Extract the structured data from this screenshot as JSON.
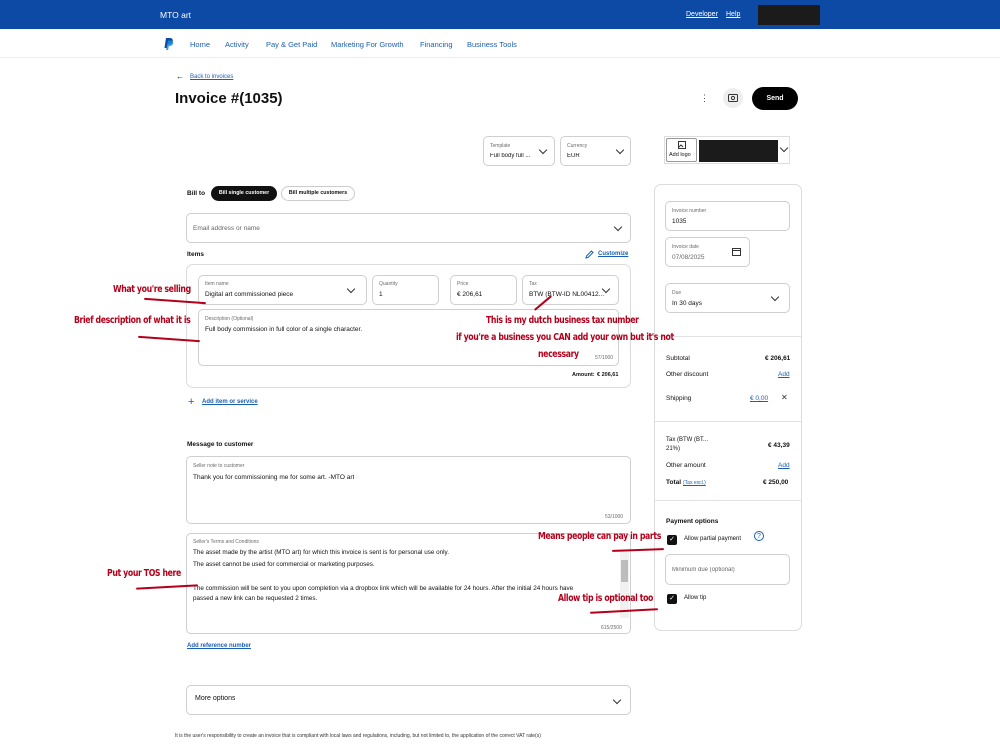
{
  "topbar": {
    "brand": "MTO art",
    "developer": "Developer",
    "help": "Help"
  },
  "nav": [
    "Home",
    "Activity",
    "Pay & Get Paid",
    "Marketing For Growth",
    "Financing",
    "Business Tools"
  ],
  "header": {
    "back": "Back to invoices",
    "title": "Invoice #(1035)",
    "more": "⋮",
    "send": "Send"
  },
  "template": {
    "label": "Template",
    "value": "Full body full ..."
  },
  "currency": {
    "label": "Currency",
    "value": "EUR"
  },
  "logo": {
    "label": "Add logo"
  },
  "billto": {
    "label": "Bill to",
    "single": "Bill single customer",
    "multiple": "Bill multiple customers",
    "email_placeholder": "Email address or name"
  },
  "items": {
    "title": "Items",
    "customize": "Customize",
    "item_name_label": "Item name",
    "item_name": "Digital art commissioned piece",
    "quantity_label": "Quantity",
    "quantity": "1",
    "price_label": "Price",
    "price": "€ 206,61",
    "tax_label": "Tax",
    "tax": "BTW (BTW-ID NL00412...",
    "desc_label": "Description (Optional)",
    "desc": "Full body commission in full color of a single character.",
    "desc_count": "57/1000",
    "amount_label": "Amount:",
    "amount": "€ 206,61",
    "add_item": "Add item or service"
  },
  "message": {
    "title": "Message to customer",
    "note_label": "Seller note to customer",
    "note": "Thank you for commissioning me for some art. -MTO art",
    "note_count": "53/1000",
    "terms_label": "Seller's Terms and Conditions",
    "terms_lines": [
      "The asset made by the artist (MTO art) for which this invoice is sent is for personal use only.",
      "The asset cannot be used for commercial or marketing purposes.",
      "",
      "The commission will be sent to you upon completion via a dropbox link which will be available for 24 hours. After the initial 24 hours have",
      "passed a new link can be requested 2 times."
    ],
    "terms_count": "615/2500",
    "add_reference": "Add reference number"
  },
  "more_options": "More options",
  "footer": "It is the user's responsibility to create an invoice that is compliant with local laws and regulations, including, but not limited to, the application of the correct VAT rate(s)",
  "side": {
    "inv_num_label": "Invoice number",
    "inv_num": "1035",
    "inv_date_label": "Invoice date",
    "inv_date": "07/08/2025",
    "due_label": "Due",
    "due": "In 30 days",
    "subtotal_label": "Subtotal",
    "subtotal": "€ 206,61",
    "discount_label": "Other discount",
    "add": "Add",
    "shipping_label": "Shipping",
    "shipping": "€ 0,00",
    "tax_label_1": "Tax (BTW (BT...",
    "tax_label_2": "21%)",
    "tax": "€ 43,39",
    "other_amount_label": "Other amount",
    "total_label": "Total",
    "tax_excl": "(Tax excl.)",
    "total": "€ 250,00",
    "payment_title": "Payment options",
    "partial": "Allow partial payment",
    "min_due_placeholder": "Minimum due (optional)",
    "tip": "Allow tip"
  },
  "annotations": {
    "selling": "What you're selling",
    "brief": "Brief description of what it is",
    "tax_1": "This is my dutch business tax number",
    "tax_2": "if you're a business you CAN add your own but it's not",
    "tax_3": "necessary",
    "partial": "Means people can pay in parts",
    "tos": "Put your TOS here",
    "tip": "Allow tip is optional too"
  },
  "colors": {
    "topbar": "#0c4aa6",
    "link": "#1a5fb4",
    "annotation": "#b3001b"
  }
}
